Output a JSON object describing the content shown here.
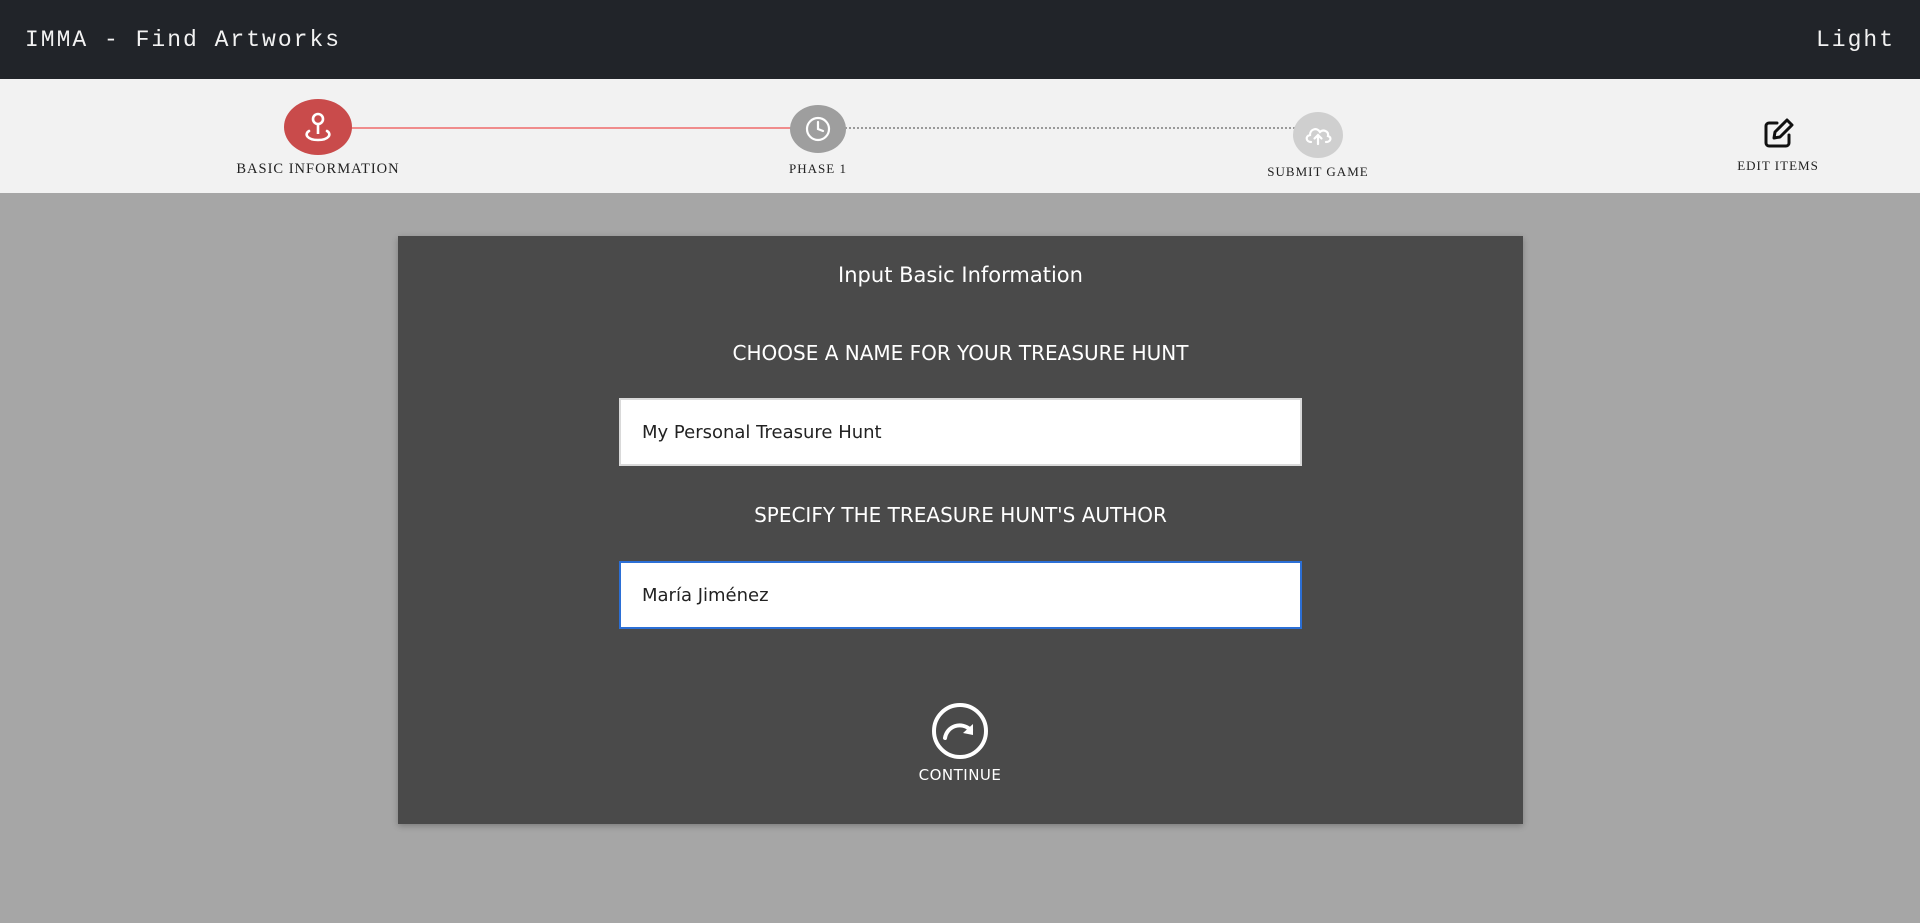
{
  "navbar": {
    "brand": "IMMA - Find Artworks",
    "theme_toggle": "Light"
  },
  "stepper": {
    "steps": [
      {
        "label": "BASIC INFORMATION",
        "icon": "location-pin-icon",
        "state": "active"
      },
      {
        "label": "PHASE 1",
        "icon": "clock-icon",
        "state": "pending"
      },
      {
        "label": "SUBMIT GAME",
        "icon": "cloud-upload-icon",
        "state": "disabled"
      },
      {
        "label": "EDIT ITEMS",
        "icon": "edit-icon",
        "state": "action"
      }
    ],
    "colors": {
      "active": "#c94b4b",
      "pending": "#9e9e9e",
      "disabled": "#cfcfcf",
      "progress_line": "#f08c8c"
    }
  },
  "form": {
    "title": "Input Basic Information",
    "name_label": "CHOOSE A NAME FOR YOUR TREASURE HUNT",
    "name_value": "My Personal Treasure Hunt",
    "author_label": "SPECIFY THE TREASURE HUNT'S AUTHOR",
    "author_value": "María Jiménez",
    "continue_label": "CONTINUE",
    "continue_icon": "redo-circle-icon"
  }
}
